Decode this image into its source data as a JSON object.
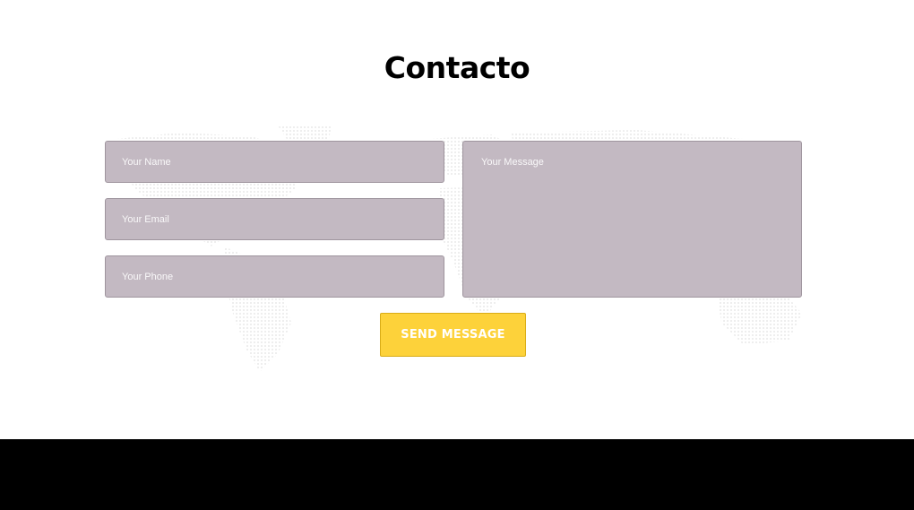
{
  "contact": {
    "title": "Contacto",
    "form": {
      "name_placeholder": "Your Name",
      "email_placeholder": "Your Email",
      "phone_placeholder": "Your Phone",
      "message_placeholder": "Your Message",
      "send_label": "SEND MESSAGE"
    }
  },
  "colors": {
    "field_background": "#c3b9c2",
    "button_background": "#fdd23a",
    "footer_background": "#000000"
  }
}
